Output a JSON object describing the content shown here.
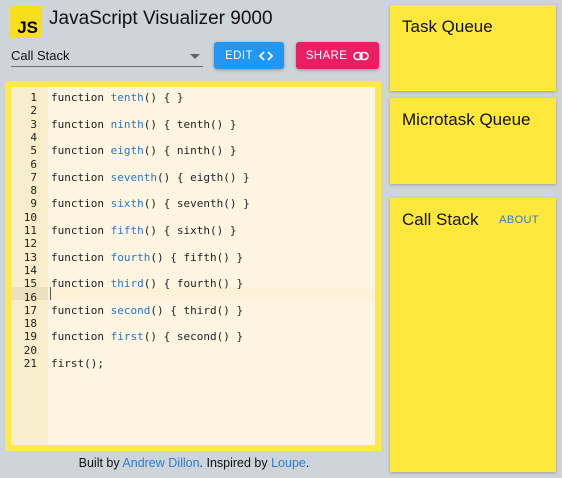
{
  "header": {
    "logo_text": "JS",
    "title": "JavaScript Visualizer 9000"
  },
  "toolbar": {
    "select_value": "Call Stack",
    "edit_label": "EDIT",
    "share_label": "SHARE"
  },
  "colors": {
    "logo": "#f7df1e",
    "edit_button": "#2196f3",
    "share_button": "#e91e63",
    "panel": "#fde83b",
    "link": "#2f7bd1"
  },
  "icons": {
    "edit": "code-brackets-icon",
    "share": "link-icon",
    "select": "chevron-down-icon"
  },
  "editor": {
    "lines": [
      {
        "num": "1",
        "pre": "function ",
        "name": "tenth",
        "post": "() { }"
      },
      {
        "num": "2",
        "pre": "",
        "name": "",
        "post": ""
      },
      {
        "num": "3",
        "pre": "function ",
        "name": "ninth",
        "post": "() { tenth() }"
      },
      {
        "num": "4",
        "pre": "",
        "name": "",
        "post": ""
      },
      {
        "num": "5",
        "pre": "function ",
        "name": "eigth",
        "post": "() { ninth() }"
      },
      {
        "num": "6",
        "pre": "",
        "name": "",
        "post": ""
      },
      {
        "num": "7",
        "pre": "function ",
        "name": "seventh",
        "post": "() { eigth() }"
      },
      {
        "num": "8",
        "pre": "",
        "name": "",
        "post": ""
      },
      {
        "num": "9",
        "pre": "function ",
        "name": "sixth",
        "post": "() { seventh() }"
      },
      {
        "num": "10",
        "pre": "",
        "name": "",
        "post": ""
      },
      {
        "num": "11",
        "pre": "function ",
        "name": "fifth",
        "post": "() { sixth() }"
      },
      {
        "num": "12",
        "pre": "",
        "name": "",
        "post": ""
      },
      {
        "num": "13",
        "pre": "function ",
        "name": "fourth",
        "post": "() { fifth() }"
      },
      {
        "num": "14",
        "pre": "",
        "name": "",
        "post": ""
      },
      {
        "num": "15",
        "pre": "function ",
        "name": "third",
        "post": "() { fourth() }"
      },
      {
        "num": "16",
        "pre": "",
        "name": "",
        "post": ""
      },
      {
        "num": "17",
        "pre": "function ",
        "name": "second",
        "post": "() { third() }"
      },
      {
        "num": "18",
        "pre": "",
        "name": "",
        "post": ""
      },
      {
        "num": "19",
        "pre": "function ",
        "name": "first",
        "post": "() { second() }"
      },
      {
        "num": "20",
        "pre": "",
        "name": "",
        "post": ""
      },
      {
        "num": "21",
        "pre": "first();",
        "name": "",
        "post": ""
      }
    ]
  },
  "footer": {
    "prefix": "Built by ",
    "author": "Andrew Dillon",
    "middle": ". Inspired by ",
    "inspiration": "Loupe",
    "suffix": "."
  },
  "panels": {
    "task_queue": "Task Queue",
    "microtask_queue": "Microtask Queue",
    "call_stack": "Call Stack",
    "about": "ABOUT"
  }
}
